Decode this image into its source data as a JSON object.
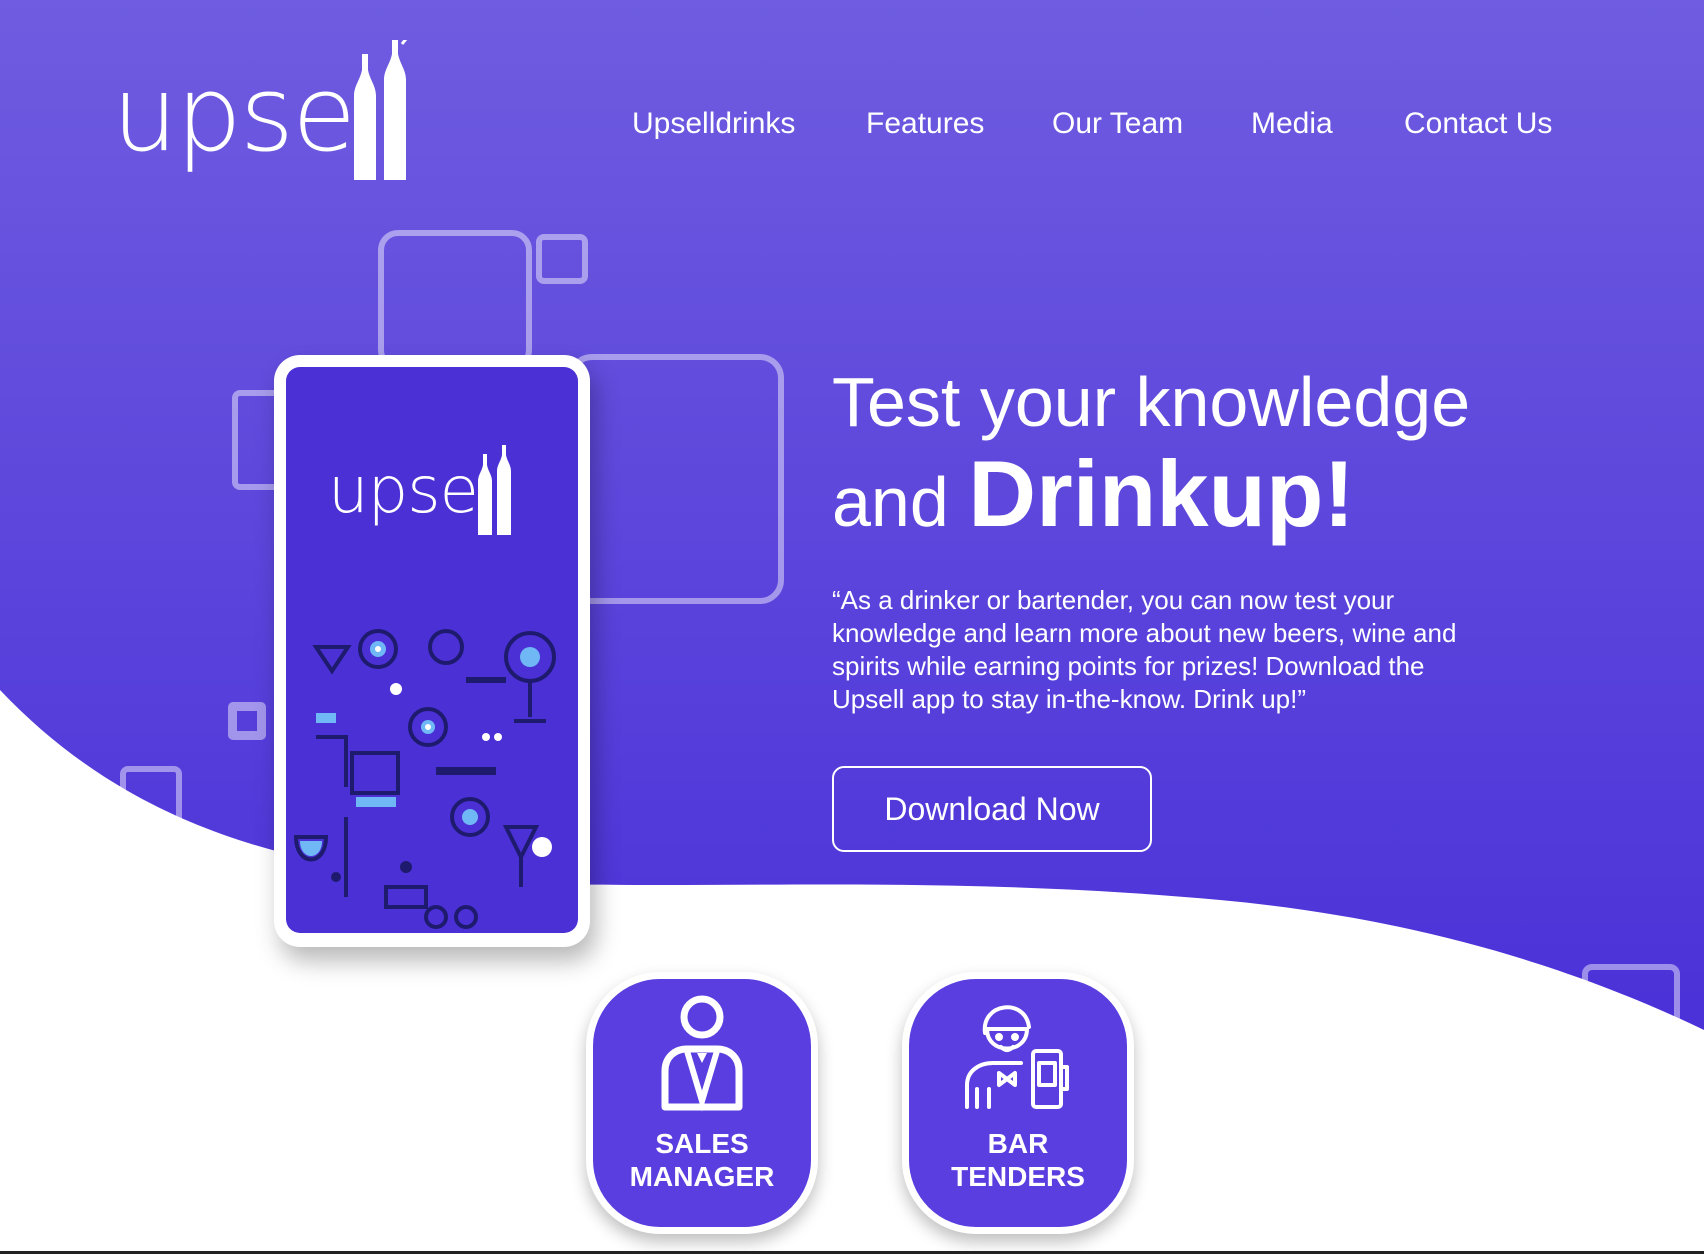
{
  "brand": {
    "logo_text": "upse",
    "colors": {
      "hero_top": "#6d5adf",
      "hero_bottom": "#4a32d8",
      "white": "#ffffff",
      "card": "#5a3ee0"
    }
  },
  "nav": {
    "items": [
      {
        "label": "Upselldrinks"
      },
      {
        "label": "Features"
      },
      {
        "label": "Our Team"
      },
      {
        "label": "Media"
      },
      {
        "label": "Contact Us"
      }
    ]
  },
  "hero": {
    "headline_line1": "Test your knowledge",
    "headline_line2_prefix": "and ",
    "headline_line2_strong": "Drinkup!",
    "quote": "“As a drinker or bartender, you can now test your knowledge and learn more about new beers, wine and spirits while earning points for prizes! Download the Upsell app to stay in-the-know. Drink up!”",
    "cta_label": "Download Now"
  },
  "phone": {
    "logo_text": "upse"
  },
  "roles": [
    {
      "label_line1": "SALES",
      "label_line2": "MANAGER",
      "icon": "sales-manager-icon"
    },
    {
      "label_line1": "BAR",
      "label_line2": "TENDERS",
      "icon": "bartender-icon"
    }
  ]
}
